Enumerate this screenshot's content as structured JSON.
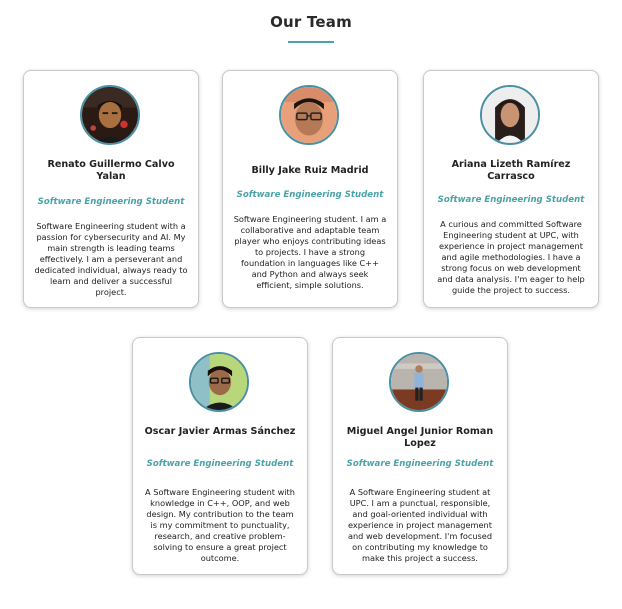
{
  "section": {
    "title": "Our Team"
  },
  "team": [
    {
      "name": "Renato Guillermo Calvo Yalan",
      "role": "Software Engineering Student",
      "bio": "Software Engineering student with a passion for cybersecurity and AI. My main strength is leading teams effectively. I am a perseverant and dedicated individual, always ready to learn and deliver a successful project.",
      "photo": "profile-photo-renato"
    },
    {
      "name": "Billy Jake Ruiz Madrid",
      "role": "Software Engineering Student",
      "bio": "Software Engineering student. I am a collaborative and adaptable team player who enjoys contributing ideas to projects. I have a strong foundation in languages like C++ and Python and always seek efficient, simple solutions.",
      "photo": "profile-photo-billy"
    },
    {
      "name": "Ariana Lizeth Ramírez Carrasco",
      "role": "Software Engineering Student",
      "bio": "A curious and committed Software Engineering student at UPC, with experience in project management and agile methodologies. I have a strong focus on web development and data analysis. I'm eager to help guide the project to success.",
      "photo": "profile-photo-ariana"
    },
    {
      "name": "Oscar Javier Armas Sánchez",
      "role": "Software Engineering Student",
      "bio": "A Software Engineering student with knowledge in C++, OOP, and web design. My contribution to the team is my commitment to punctuality, research, and creative problem-solving to ensure a great project outcome.",
      "photo": "profile-photo-oscar"
    },
    {
      "name": "Miguel Angel Junior Roman Lopez",
      "role": "Software Engineering Student",
      "bio": "A Software Engineering student at UPC. I am a punctual, responsible, and goal-oriented individual with experience in project management and web development. I'm focused on contributing my knowledge to make this project a success.",
      "photo": "profile-photo-miguel"
    }
  ],
  "colors": {
    "accent": "#4aa3a8",
    "avatar_ring": "#4a90a5",
    "card_border": "#c9c9c9",
    "text": "#222222"
  }
}
